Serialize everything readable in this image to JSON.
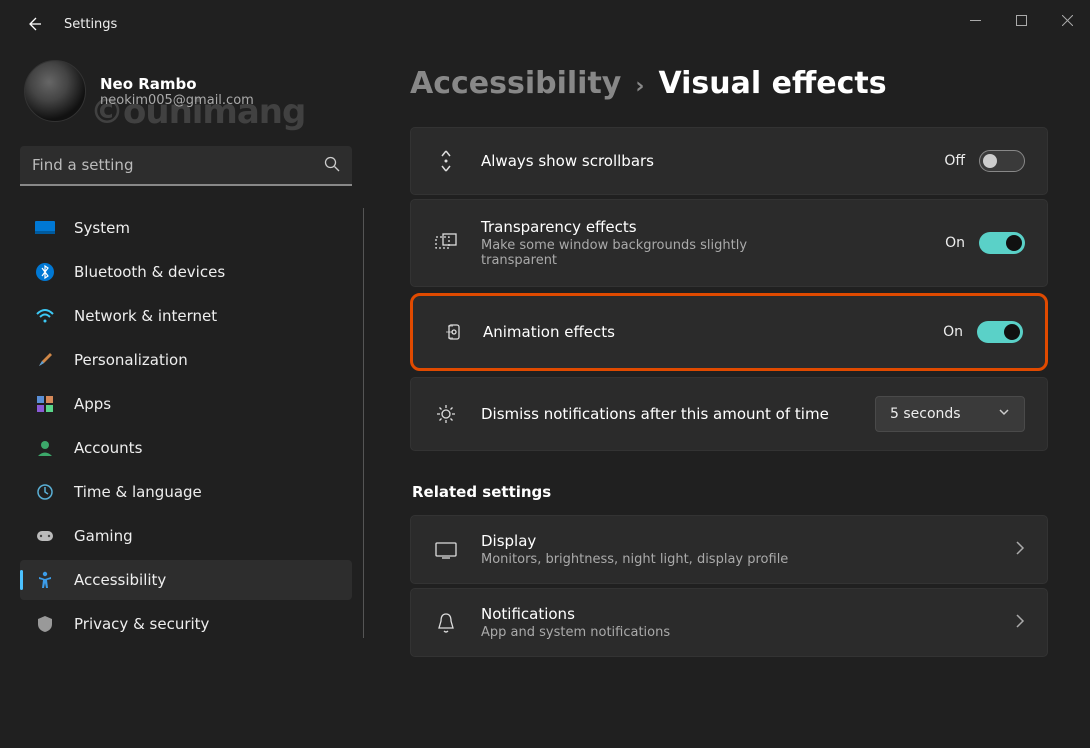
{
  "app_title": "Settings",
  "user": {
    "name": "Neo Rambo",
    "email": "neokim005@gmail.com"
  },
  "search": {
    "placeholder": "Find a setting"
  },
  "nav": {
    "items": [
      {
        "id": "system",
        "label": "System"
      },
      {
        "id": "bluetooth",
        "label": "Bluetooth & devices"
      },
      {
        "id": "network",
        "label": "Network & internet"
      },
      {
        "id": "personalization",
        "label": "Personalization"
      },
      {
        "id": "apps",
        "label": "Apps"
      },
      {
        "id": "accounts",
        "label": "Accounts"
      },
      {
        "id": "time",
        "label": "Time & language"
      },
      {
        "id": "gaming",
        "label": "Gaming"
      },
      {
        "id": "accessibility",
        "label": "Accessibility"
      },
      {
        "id": "privacy",
        "label": "Privacy & security"
      }
    ]
  },
  "breadcrumb": {
    "parent": "Accessibility",
    "current": "Visual effects"
  },
  "settings": {
    "scrollbars": {
      "title": "Always show scrollbars",
      "state_label": "Off",
      "state": "off"
    },
    "transparency": {
      "title": "Transparency effects",
      "desc": "Make some window backgrounds slightly transparent",
      "state_label": "On",
      "state": "on"
    },
    "animation": {
      "title": "Animation effects",
      "state_label": "On",
      "state": "on"
    },
    "dismiss": {
      "title": "Dismiss notifications after this amount of time",
      "value": "5 seconds"
    }
  },
  "related": {
    "heading": "Related settings",
    "display": {
      "title": "Display",
      "desc": "Monitors, brightness, night light, display profile"
    },
    "notifications": {
      "title": "Notifications",
      "desc": "App and system notifications"
    }
  },
  "watermark": "©ounimang"
}
